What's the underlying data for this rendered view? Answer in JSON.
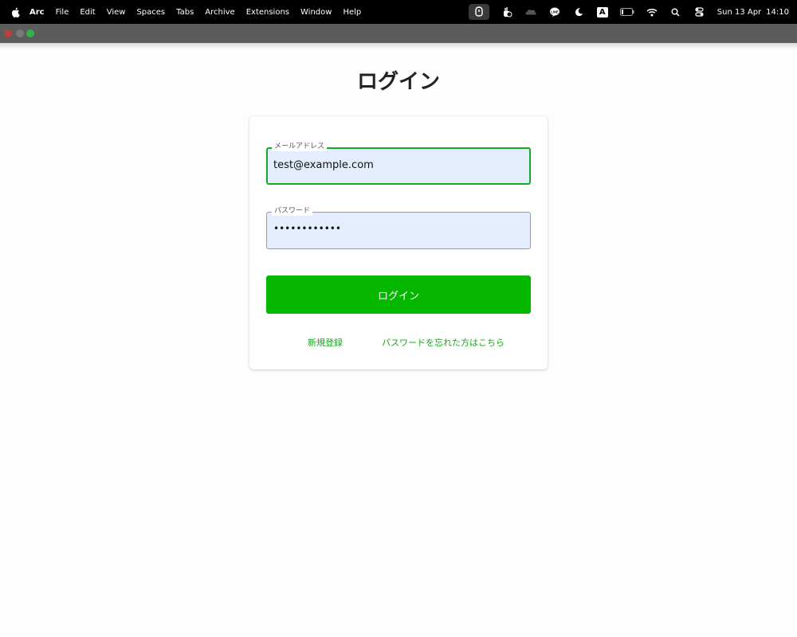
{
  "menubar": {
    "app_name": "Arc",
    "items": [
      "File",
      "Edit",
      "View",
      "Spaces",
      "Tabs",
      "Archive",
      "Extensions",
      "Window",
      "Help"
    ],
    "status_icons": [
      "cursor-app-icon",
      "gesture-icon",
      "cloud-icon",
      "line-icon",
      "moon-icon",
      "keyboard-input-icon",
      "battery-icon",
      "wifi-icon",
      "search-icon",
      "control-center-icon"
    ],
    "keyboard_input": "A",
    "clock": {
      "date": "Sun 13 Apr",
      "time": "14:10"
    }
  },
  "page": {
    "title": "ログイン"
  },
  "form": {
    "email": {
      "label": "メールアドレス",
      "value": "test@example.com"
    },
    "password": {
      "label": "パスワード",
      "value": "••••••••••••"
    },
    "submit_label": "ログイン",
    "links": {
      "register": "新規登録",
      "forgot_password": "パスワードを忘れた方はこちら"
    }
  },
  "colors": {
    "accent_green": "#06b700",
    "focus_border": "#17a928",
    "input_background": "#e4edfd"
  }
}
